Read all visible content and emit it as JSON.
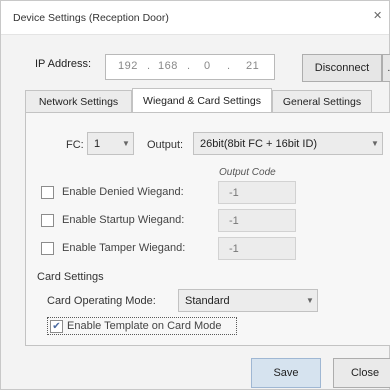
{
  "window": {
    "title": "Device Settings (Reception Door)",
    "close_glyph": "✕"
  },
  "connection": {
    "ip_label": "IP Address:",
    "ip_segments": [
      "192",
      "168",
      "0",
      "21"
    ],
    "disconnect_label": "Disconnect",
    "extra_button_label": "…"
  },
  "tabs": [
    {
      "label": "Network Settings",
      "active": false
    },
    {
      "label": "Wiegand & Card Settings",
      "active": true
    },
    {
      "label": "General Settings",
      "active": false
    }
  ],
  "wiegand": {
    "fc_label": "FC:",
    "fc_value": "1",
    "output_label": "Output:",
    "output_value": "26bit(8bit FC + 16bit ID)",
    "output_code_header": "Output Code",
    "options": [
      {
        "label": "Enable Denied Wiegand:",
        "checked": false,
        "code": "-1"
      },
      {
        "label": "Enable Startup Wiegand:",
        "checked": false,
        "code": "-1"
      },
      {
        "label": "Enable Tamper Wiegand:",
        "checked": false,
        "code": "-1"
      }
    ]
  },
  "card_settings": {
    "group_label": "Card Settings",
    "mode_label": "Card Operating Mode:",
    "mode_value": "Standard",
    "template_label": "Enable Template on Card Mode",
    "template_checked": true,
    "check_glyph": "✔"
  },
  "footer": {
    "save_label": "Save",
    "close_label": "Close"
  },
  "icons": {
    "dropdown": "chevron-down-icon",
    "check": "checkmark-icon"
  },
  "colors": {
    "save_button": "#d6e3ef",
    "panel": "#f7f7f7"
  }
}
